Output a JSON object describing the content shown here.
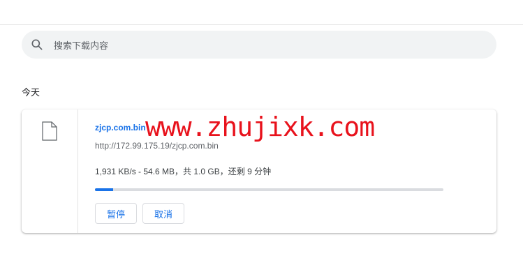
{
  "search": {
    "placeholder": "搜索下载内容",
    "icon": "search-icon"
  },
  "section": {
    "date_label": "今天"
  },
  "download": {
    "filename": "zjcp.com.bin",
    "url": "http://172.99.175.19/zjcp.com.bin",
    "status": "1,931 KB/s - 54.6 MB，共 1.0 GB，还剩 9 分钟",
    "progress_fraction": 0.053,
    "file_icon": "file-icon",
    "pause_label": "暂停",
    "cancel_label": "取消"
  },
  "watermark": {
    "text": "www.zhujixk.com",
    "color": "#e8121c"
  },
  "colors": {
    "accent": "#1a73e8",
    "search_bg": "#f1f3f4"
  }
}
